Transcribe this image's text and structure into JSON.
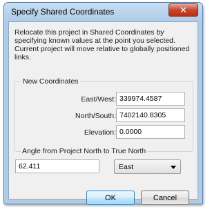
{
  "window": {
    "title": "Specify Shared Coordinates",
    "close_glyph": "✕"
  },
  "description": "Relocate this project in Shared Coordinates by specifying known values at the point you selected. Current project will move relative to globally positioned links.",
  "new_coordinates": {
    "legend": "New Coordinates",
    "east_west_label": "East/West:",
    "east_west_value": "339974.4587",
    "north_south_label": "North/South:",
    "north_south_value": "7402140.8305",
    "elevation_label": "Elevation:",
    "elevation_value": "0.0000"
  },
  "angle": {
    "legend": "Angle from Project North to True North",
    "value": "62.411",
    "direction_selected": "East"
  },
  "buttons": {
    "ok_label": "OK",
    "cancel_label": "Cancel"
  },
  "colors": {
    "title_bar": "#aecbe8",
    "close_button": "#c9452b",
    "dialog_body": "#f0f0f0"
  }
}
